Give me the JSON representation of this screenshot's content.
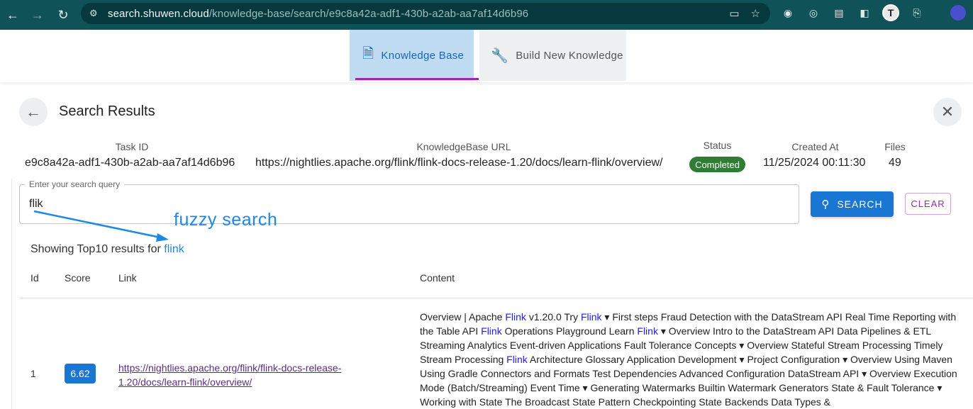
{
  "browser": {
    "url_host": "search.shuwen.cloud",
    "url_path": "/knowledge-base/search/e9c8a42a-adf1-430b-a2ab-aa7af14d6b96",
    "avatar_letter": "T"
  },
  "tabs": [
    {
      "label": "Knowledge Base",
      "icon": "upload-file-icon"
    },
    {
      "label": "Build New Knowledge",
      "icon": "wrench-icon"
    }
  ],
  "header": {
    "title": "Search Results"
  },
  "info": {
    "task_id_label": "Task ID",
    "task_id": "e9c8a42a-adf1-430b-a2ab-aa7af14d6b96",
    "kb_url_label": "KnowledgeBase URL",
    "kb_url": "https://nightlies.apache.org/flink/flink-docs-release-1.20/docs/learn-flink/overview/",
    "status_label": "Status",
    "status": "Completed",
    "created_label": "Created At",
    "created": "11/25/2024 00:11:30",
    "files_label": "Files",
    "files": "49"
  },
  "search": {
    "legend": "Enter your search query",
    "value": "flik",
    "search_label": "SEARCH",
    "clear_label": "CLEAR"
  },
  "annotation": "fuzzy search",
  "results": {
    "prefix": "Showing Top10 results for ",
    "query": "flink"
  },
  "table": {
    "headers": {
      "id": "Id",
      "score": "Score",
      "link": "Link",
      "content": "Content"
    },
    "rows": [
      {
        "id": "1",
        "score": "6.62",
        "link": "https://nightlies.apache.org/flink/flink-docs-release-1.20/docs/learn-flink/overview/",
        "content_segments": [
          {
            "t": "Overview | Apache "
          },
          {
            "t": "Flink",
            "hl": true
          },
          {
            "t": " v1.20.0 Try "
          },
          {
            "t": "Flink",
            "hl": true
          },
          {
            "t": " ▾ First steps Fraud Detection with the DataStream API Real Time Reporting with the Table API "
          },
          {
            "t": "Flink",
            "hl": true
          },
          {
            "t": " Operations Playground Learn "
          },
          {
            "t": "Flink",
            "hl": true
          },
          {
            "t": " ▾ Overview Intro to the DataStream API Data Pipelines & ETL Streaming Analytics Event-driven Applications Fault Tolerance Concepts ▾ Overview Stateful Stream Processing Timely Stream Processing "
          },
          {
            "t": "Flink",
            "hl": true
          },
          {
            "t": " Architecture Glossary Application Development ▾ Project Configuration ▾ Overview Using Maven Using Gradle Connectors and Formats Test Dependencies Advanced Configuration DataStream API ▾ Overview Execution Mode (Batch/Streaming) Event Time ▾ Generating Watermarks Builtin Watermark Generators State & Fault Tolerance ▾ Working with State The Broadcast State Pattern Checkpointing State Backends Data Types &"
          }
        ]
      }
    ]
  }
}
